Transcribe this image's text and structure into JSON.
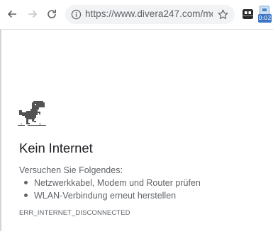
{
  "browser": {
    "url": "https://www.divera247.com/mon...",
    "extension_badge_text": "0:02"
  },
  "icons": {
    "back": "arrow-left-icon",
    "forward": "arrow-right-icon",
    "reload": "reload-icon",
    "info": "info-icon",
    "bookmark": "star-icon",
    "extension": "extension-icon",
    "timer_extension": "timer-extension-icon",
    "dino": "offline-dinosaur-icon"
  },
  "error_page": {
    "heading": "Kein Internet",
    "suggestions_intro": "Versuchen Sie Folgendes:",
    "suggestions": [
      "Netzwerkkabel, Modem und Router prüfen",
      "WLAN-Verbindung erneut herstellen"
    ],
    "error_code": "ERR_INTERNET_DISCONNECTED"
  },
  "colors": {
    "text_primary": "#202124",
    "text_secondary": "#5f6368",
    "omnibox_bg": "#f1f3f4",
    "badge_bg": "#3d74c4"
  }
}
